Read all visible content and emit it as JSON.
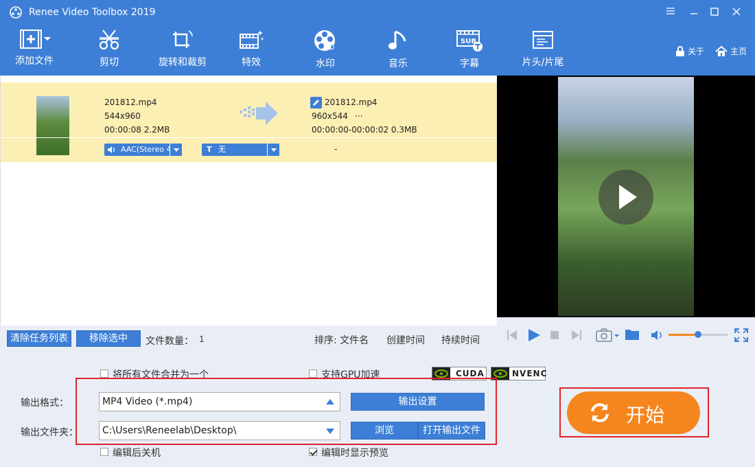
{
  "window": {
    "title": "Renee Video Toolbox 2019"
  },
  "toolbar": {
    "items": [
      {
        "label": "添加文件"
      },
      {
        "label": "剪切"
      },
      {
        "label": "旋转和裁剪"
      },
      {
        "label": "特效"
      },
      {
        "label": "水印"
      },
      {
        "label": "音乐"
      },
      {
        "label": "字幕"
      },
      {
        "label": "片头/片尾"
      }
    ],
    "about": "关于",
    "home": "主页",
    "subtitle_badge": "SUB"
  },
  "file": {
    "src_name": "201812.mp4",
    "src_res": "544x960",
    "src_meta": "00:00:08 2.2MB",
    "out_name": "201812.mp4",
    "out_res": "960x544",
    "out_more": "···",
    "out_meta": "00:00:00-00:00:02 0.3MB",
    "audio": "AAC(Stereo 4",
    "subtitle": "无",
    "subtitle_icon": "T",
    "dash": "-"
  },
  "listbar": {
    "clear": "清除任务列表",
    "remove": "移除选中",
    "count_label": "文件数量：",
    "count": "1",
    "sort_label": "排序: 文件名",
    "sort_created": "创建时间",
    "sort_duration": "持续时间"
  },
  "options": {
    "merge": "将所有文件合并为一个",
    "gpu": "支持GPU加速",
    "cuda": "CUDA",
    "nvenc": "NVENC",
    "shutdown": "编辑后关机",
    "preview": "编辑时显示预览"
  },
  "output": {
    "format_label": "输出格式：",
    "format_value": "MP4 Video (*.mp4)",
    "settings_btn": "输出设置",
    "folder_label": "输出文件夹：",
    "folder_value": "C:\\Users\\Reneelab\\Desktop\\",
    "browse_btn": "浏览",
    "open_btn": "打开输出文件"
  },
  "start": {
    "label": "开始"
  },
  "colors": {
    "accent": "#3d7fd6",
    "start": "#f5861e",
    "highlight": "#fcefb4",
    "frame": "#e0222b"
  }
}
